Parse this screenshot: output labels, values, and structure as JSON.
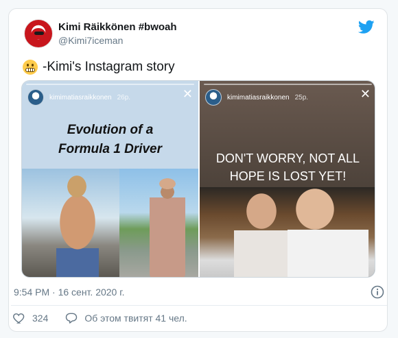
{
  "tweet": {
    "display_name": "Kimi Räikkönen #bwoah",
    "handle": "@Kimi7iceman",
    "text": "-Kimi's Instagram story",
    "emoji_icon": "grimacing-face-emoji",
    "timestamp": "9:54 PM · 16 сент. 2020 г.",
    "likes": "324",
    "comment_label": "Об этом твитят 41 чел."
  },
  "media": {
    "left_story": {
      "username": "kimimatiasraikkonen",
      "time": "26р.",
      "title_line1": "Evolution of a",
      "title_line2": "Formula 1 Driver"
    },
    "right_story": {
      "username": "kimimatiasraikkonen",
      "time": "25р.",
      "title_line1": "DON'T WORRY, NOT ALL",
      "title_line2": "HOPE IS LOST YET!"
    },
    "close_glyph": "✕"
  },
  "colors": {
    "twitter_blue": "#1da1f2",
    "secondary_text": "#657786"
  }
}
